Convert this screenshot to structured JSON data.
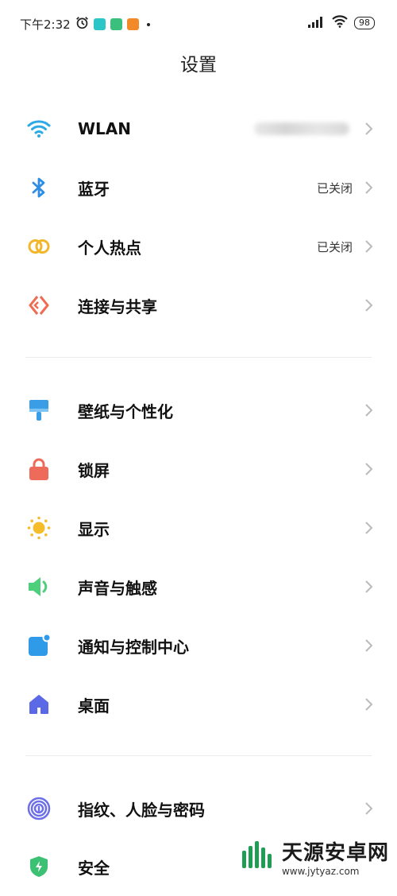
{
  "status_bar": {
    "time": "下午2:32",
    "battery": "98"
  },
  "header": {
    "title": "设置"
  },
  "groups": [
    {
      "items": [
        {
          "label": "WLAN",
          "value": ""
        },
        {
          "label": "蓝牙",
          "value": "已关闭"
        },
        {
          "label": "个人热点",
          "value": "已关闭"
        },
        {
          "label": "连接与共享",
          "value": ""
        }
      ]
    },
    {
      "items": [
        {
          "label": "壁纸与个性化",
          "value": ""
        },
        {
          "label": "锁屏",
          "value": ""
        },
        {
          "label": "显示",
          "value": ""
        },
        {
          "label": "声音与触感",
          "value": ""
        },
        {
          "label": "通知与控制中心",
          "value": ""
        },
        {
          "label": "桌面",
          "value": ""
        }
      ]
    },
    {
      "items": [
        {
          "label": "指纹、人脸与密码",
          "value": ""
        },
        {
          "label": "安全",
          "value": ""
        }
      ]
    }
  ],
  "watermark": {
    "title": "天源安卓网",
    "url": "www.jytyaz.com"
  },
  "colors": {
    "wlan": "#2fa9e6",
    "bluetooth": "#2f8de4",
    "hotspot": "#f2b62b",
    "share": "#ef6b52",
    "wallpaper": "#3a9ee6",
    "lock": "#ee6a5a",
    "display": "#f6bd2b",
    "sound": "#4dcf7c",
    "notify": "#2f9be8",
    "desktop": "#5b69e6",
    "fingerprint": "#6d6fe8",
    "security": "#3cc073"
  }
}
